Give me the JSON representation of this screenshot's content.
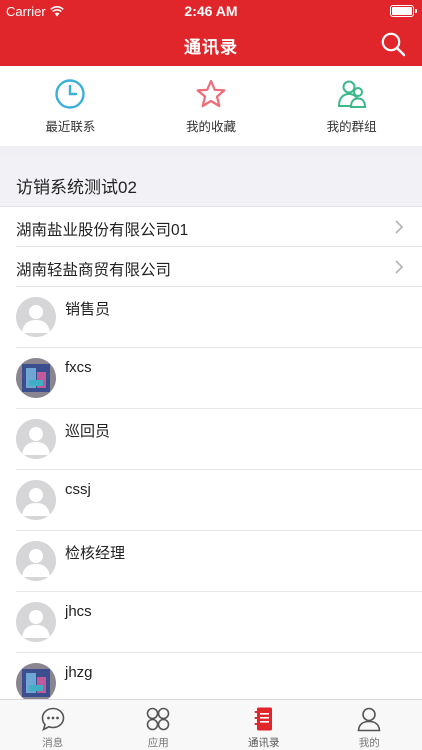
{
  "status_bar": {
    "carrier": "Carrier",
    "time": "2:46 AM"
  },
  "header": {
    "title": "通讯录"
  },
  "quick_links": [
    {
      "label": "最近联系",
      "icon": "clock-icon",
      "color": "#3ab0d8"
    },
    {
      "label": "我的收藏",
      "icon": "star-icon",
      "color": "#ef6b78"
    },
    {
      "label": "我的群组",
      "icon": "group-icon",
      "color": "#3cb88a"
    }
  ],
  "group": {
    "title": "访销系统测试02"
  },
  "companies": [
    {
      "name": "湖南盐业股份有限公司01"
    },
    {
      "name": "湖南轻盐商贸有限公司"
    }
  ],
  "contacts": [
    {
      "name": "销售员",
      "avatar": "default"
    },
    {
      "name": "fxcs",
      "avatar": "photo"
    },
    {
      "name": "巡回员",
      "avatar": "default"
    },
    {
      "name": "cssj",
      "avatar": "default"
    },
    {
      "name": "检核经理",
      "avatar": "default"
    },
    {
      "name": "jhcs",
      "avatar": "default"
    },
    {
      "name": "jhzg",
      "avatar": "photo"
    }
  ],
  "tabbar": [
    {
      "label": "消息",
      "icon": "chat-icon"
    },
    {
      "label": "应用",
      "icon": "apps-icon"
    },
    {
      "label": "通讯录",
      "icon": "contacts-book-icon",
      "active": true
    },
    {
      "label": "我的",
      "icon": "profile-icon"
    }
  ],
  "colors": {
    "brand": "#e0262b"
  }
}
